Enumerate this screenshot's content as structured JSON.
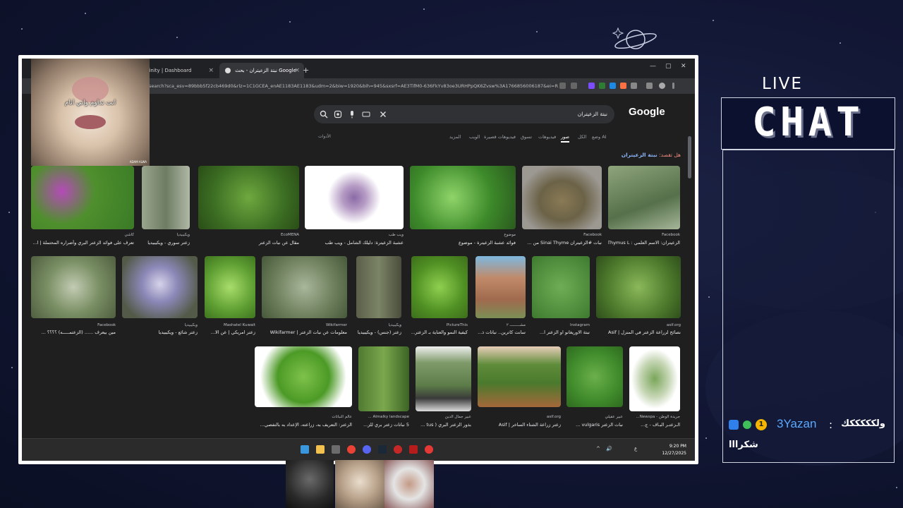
{
  "browser": {
    "tabs": [
      {
        "label": "finity | Dashboard",
        "close": "×"
      },
      {
        "label": "نبتة الزعيتران - بحث Google",
        "close": "×"
      }
    ],
    "new_tab": "+",
    "window_controls": [
      "—",
      "▢",
      "✕"
    ],
    "url": "search?sca_esv=89bbb5f22cb469d0&rlz=1C1GCEA_enAE1183AE1183&udm=2&biw=1920&bih=945&sxsrf=AE3TifM0-636FkYv83oe3URHPpQK6Zvsw%3A1766856006187&ei=RhVQadWUC5..."
  },
  "search": {
    "logo": "Google",
    "query": "نبتة الزعيتران",
    "tabs": [
      "وضع AI",
      "الكل",
      "صور",
      "فيديوهات",
      "تسوق",
      "فيديوهات قصيرة",
      "الويب",
      "المزيد"
    ],
    "active_tab": "صور",
    "tools": "الأدوات",
    "did_you_mean_label": "هل تقصد:",
    "did_you_mean_term": "نبتة الزعيتران"
  },
  "images": [
    {
      "source": "Facebook",
      "title": "الزعيتران: الاسم العلمي : Thymus L ..."
    },
    {
      "source": "Facebook",
      "title": "نبات #الزعيتران Sinai Thyme من ..."
    },
    {
      "source": "موضوع",
      "title": "فوائد عشبة الزعيترة - موضوع"
    },
    {
      "source": "ويب طب",
      "title": "عشبة الزعيترة: دليلك الشامل - ويب طب"
    },
    {
      "source": "EcoMENA",
      "title": "مقال عن نبات الزعتر"
    },
    {
      "source": "ويكيبيديا",
      "title": "زعتر سوري - ويكيبيديا"
    },
    {
      "source": "كاشي",
      "title": "تعرف على فوائد الزعتر البري وأضراره المحتملة | ا..."
    },
    {
      "source": "asif.org",
      "title": "نصائح لزراعة الزعتر في المنزل | Asif"
    },
    {
      "source": "Instagram",
      "title": "نبتة الاوريغانو او الزعتر ا..."
    },
    {
      "source": "مشـــــــــ ٢",
      "title": "سانت كاترين.. نباتات ذ..."
    },
    {
      "source": "PictureThis",
      "title": "كيفية النمو والعناية بـ الزعتر..."
    },
    {
      "source": "ويكيبيديا",
      "title": "زعتر (جنس) - ويكيبيديا"
    },
    {
      "source": "Wikifarmer",
      "title": "معلومات عن نبات الزعتر | Wikifarmer"
    },
    {
      "source": "Mashatel Kuwait",
      "title": "زعتر امريكي | عن الا..."
    },
    {
      "source": "ويكيبيديا",
      "title": "زعتر شائع - ويكيبيديا"
    },
    {
      "source": "Facebook",
      "title": "مين بيعرف ...... (الزعتمـــــه) ؟؟؟؟ ..."
    },
    {
      "source": "جريدة الوطن - Newspa...",
      "title": "الـزعتـر البـاف - ج..."
    },
    {
      "source": "عبير عقيلي",
      "title": "نبات الزعتر vulgaris ..."
    },
    {
      "source": "asif.org",
      "title": "زعتر زراعة الشتاء الساخر | Asif"
    },
    {
      "source": "عبير جمال الدين",
      "title": "بذور الزعتر البري ( tus ..."
    },
    {
      "source": "Almalky landscape ...",
      "title": "5 نباتات زعتر بري للز..."
    },
    {
      "source": "عالم النباتات",
      "title": "الزعتر: التعريف به، زراعته، الإعداد به بالتفصي..."
    }
  ],
  "taskbar": {
    "time": "9:20 PM",
    "date": "12/27/2025",
    "tray": [
      "^",
      "🔊",
      "ع"
    ]
  },
  "webcam": {
    "caption": "انت تداوم واني انام",
    "watermark": "ADAM ALWA"
  },
  "chat": {
    "live_label": "LIVE",
    "title": "CHAT",
    "messages": [
      {
        "username": "3Yazan",
        "separator": ":",
        "text": "ولكككككك",
        "badge_number": "1"
      },
      {
        "text": "شكرااا"
      }
    ]
  },
  "colors": {
    "background": "#121735",
    "chat_username": "#5aa9ff",
    "browser_bg": "#202124",
    "did_you_mean": "#f28b82"
  }
}
